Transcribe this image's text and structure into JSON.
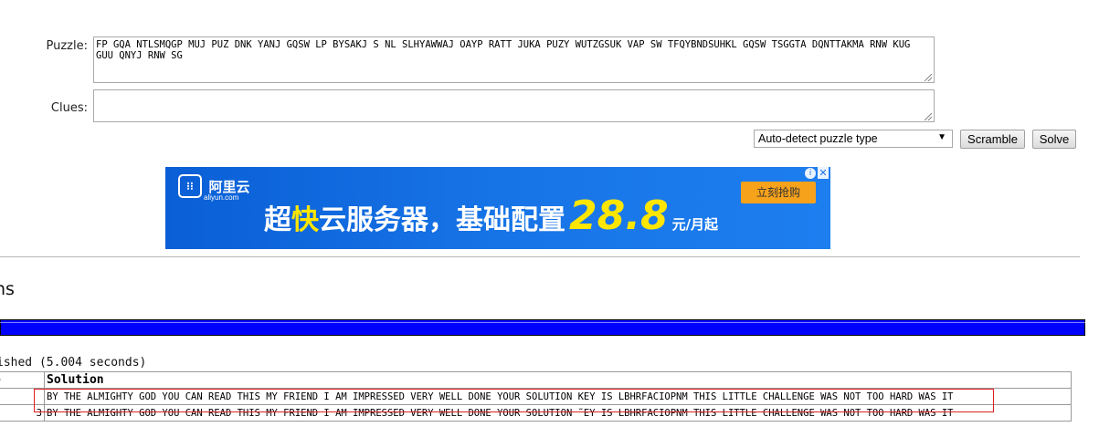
{
  "form": {
    "puzzle_label": "Puzzle:",
    "puzzle_value": "FP GQA NTLSMQGP MUJ PUZ DNK YANJ GQSW LP BYSAKJ S NL SLHYAWWAJ OAYP RATT JUKA PUZY WUTZGSUK VAP SW TFQYBNDSUHKL GQSW TSGGTA DQNTTAKMA RNW KUG GUU QNYJ RNW SG",
    "clues_label": "Clues:",
    "clues_value": "",
    "puzzle_type_selected": "Auto-detect puzzle type",
    "scramble_label": "Scramble",
    "solve_label": "Solve"
  },
  "ad": {
    "logo_cn": "阿里云",
    "logo_en": "aliyun.com",
    "headline_pre": "超",
    "headline_hl": "快",
    "headline_post": "云服务器，基础配置",
    "price": "28.8",
    "unit": "元/月起",
    "cta": "立刻抢购",
    "info_glyph": "i",
    "close_glyph": "✕"
  },
  "results": {
    "section_title": "ns",
    "progress_percent": 100,
    "status": "ished (5.004 seconds)",
    "columns": [
      "e",
      "Solution"
    ],
    "rows": [
      {
        "score": "",
        "solution": "BY THE ALMIGHTY GOD YOU CAN READ THIS MY FRIEND I AM IMPRESSED VERY WELL DONE YOUR SOLUTION KEY IS LBHRFACIOPNM THIS LITTLE CHALLENGE WAS NOT TOO HARD WAS IT"
      },
      {
        "score": "3",
        "solution": "BY THE ALMIGHTY GOD YOU CAN READ THIS MY FRIEND I AM IMPRESSED VERY WELL DONE YOUR SOLUTION ˜EY IS LBHRFACIOPNM THIS LITTLE CHALLENGE WAS NOT TOO HARD WAS IT"
      }
    ]
  }
}
